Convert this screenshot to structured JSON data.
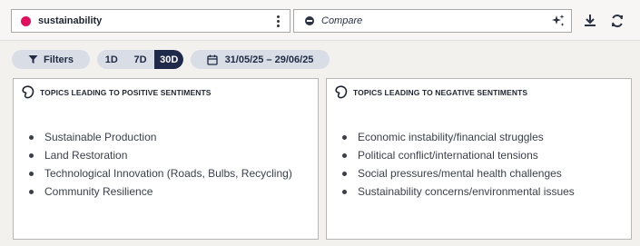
{
  "query": {
    "label": "sustainability",
    "color": "#e0105f"
  },
  "compare": {
    "placeholder": "Compare"
  },
  "toolbar": {
    "download_icon": "download-icon",
    "refresh_icon": "refresh-icon",
    "ai_icon": "sparkle-icon"
  },
  "filters": {
    "filters_label": "Filters",
    "ranges": [
      {
        "label": "1D",
        "active": false
      },
      {
        "label": "7D",
        "active": false
      },
      {
        "label": "30D",
        "active": true
      }
    ],
    "date_range": "31/05/25 – 29/06/25"
  },
  "panels": {
    "positive": {
      "title": "TOPICS LEADING TO POSITIVE SENTIMENTS",
      "topics": [
        "Sustainable Production",
        "Land Restoration",
        "Technological Innovation (Roads, Bulbs, Recycling)",
        "Community Resilience"
      ]
    },
    "negative": {
      "title": "TOPICS LEADING TO NEGATIVE SENTIMENTS",
      "topics": [
        "Economic instability/financial struggles",
        "Political conflict/international tensions",
        "Social pressures/mental health challenges",
        "Sustainability concerns/environmental issues"
      ]
    }
  },
  "colors": {
    "accent": "#e0105f",
    "pill_bg": "#d9dde5",
    "active_range": "#1f2a4a",
    "page_bg": "#f3f1ee"
  }
}
